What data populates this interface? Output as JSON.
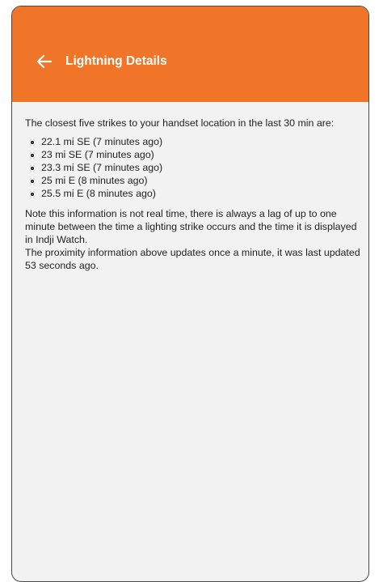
{
  "header": {
    "title": "Lightning Details",
    "back_icon": "arrow-left-icon",
    "background_color": "#f07528"
  },
  "content": {
    "intro": "The closest five strikes to your handset location in the last 30 min are:",
    "strikes": [
      "22.1 mi SE (7 minutes ago)",
      "23 mi SE (7 minutes ago)",
      "23.3 mi SE (7 minutes ago)",
      "25 mi E (8 minutes ago)",
      "25.5 mi E (8 minutes ago)"
    ],
    "note_line1": "Note this information is not real time, there is always a lag of up to one minute between the time a lighting strike occurs and the time it is displayed in Indji Watch.",
    "note_line2": "The proximity information above updates once a minute, it was last updated 53 seconds ago."
  }
}
